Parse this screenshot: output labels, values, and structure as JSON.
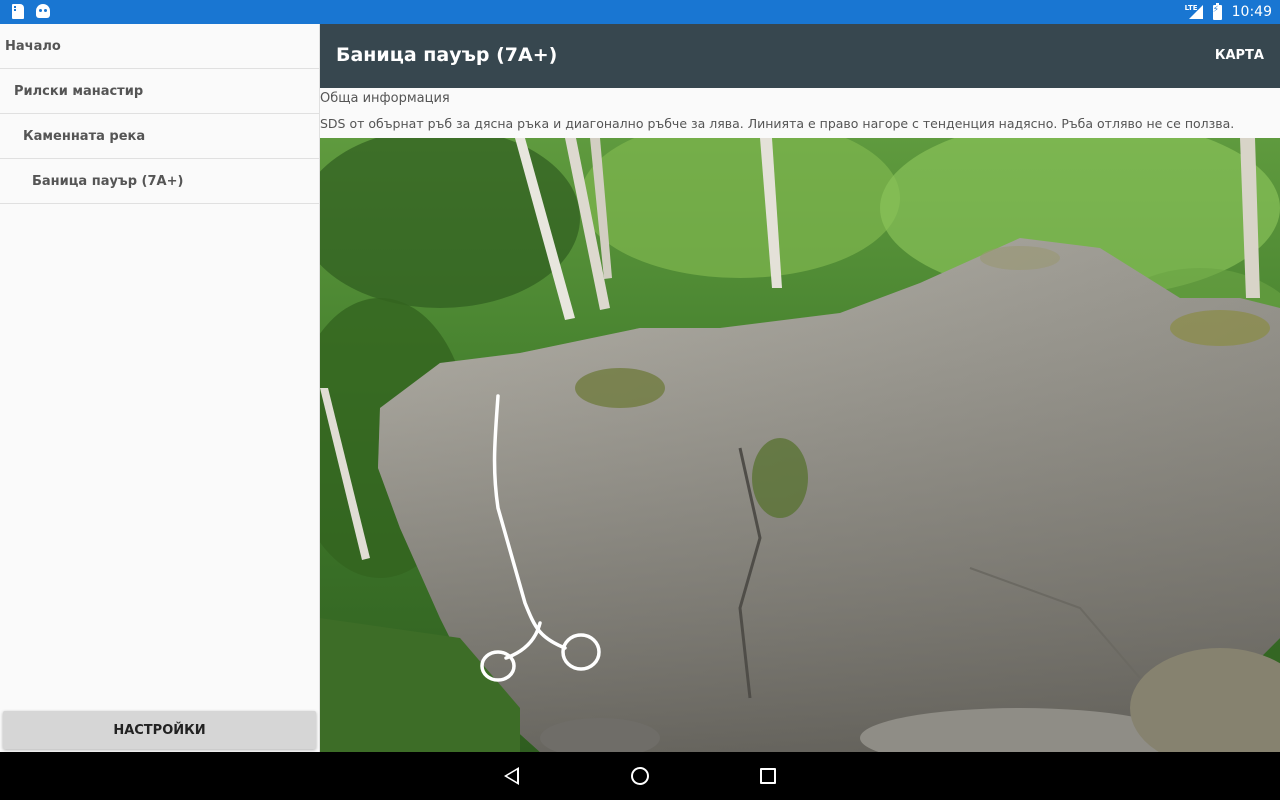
{
  "status_bar": {
    "time": "10:49",
    "network": "LTE",
    "icons": [
      "sd-card-icon",
      "android-debug-icon",
      "signal-icon",
      "battery-charging-icon"
    ]
  },
  "drawer": {
    "items": [
      {
        "label": "Начало"
      },
      {
        "label": "Рилски манастир"
      },
      {
        "label": "Каменната река"
      },
      {
        "label": "Баница пауър (7A+)"
      }
    ],
    "settings_label": "НАСТРОЙКИ"
  },
  "toolbar": {
    "title": "Баница пауър (7A+)",
    "map_action": "КАРТА"
  },
  "content": {
    "section_heading": "Обща информация",
    "description": "SDS от обърнат ръб за дясна ръка и диагонално ръбче за лява. Линията е право нагоре с тенденция надясно. Ръба отляво не се ползва."
  },
  "colors": {
    "status_bar": "#1976d2",
    "toolbar": "#37474f",
    "drawer_bg": "#fafafa",
    "settings_button": "#d6d6d6",
    "route_line": "#ffffff"
  },
  "nav_bar": {
    "icons": [
      "back-icon",
      "home-icon",
      "recents-icon"
    ]
  }
}
